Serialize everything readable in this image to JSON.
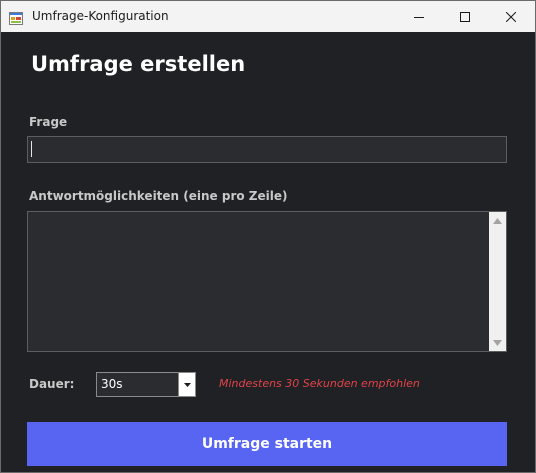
{
  "window": {
    "title": "Umfrage-Konfiguration",
    "icon": "app-form-icon",
    "controls": [
      "minimize-icon",
      "maximize-icon",
      "close-icon"
    ]
  },
  "form": {
    "heading": "Umfrage erstellen",
    "question": {
      "label": "Frage",
      "value": ""
    },
    "answers": {
      "label": "Antwortmöglichkeiten (eine pro Zeile)",
      "value": ""
    },
    "duration": {
      "label": "Dauer:",
      "selected": "30s",
      "hint": "Mindestens 30 Sekunden empfohlen"
    },
    "submit_label": "Umfrage starten"
  },
  "colors": {
    "background": "#202124",
    "field": "#2b2c30",
    "accent": "#5865f2",
    "hint": "#e0434a"
  }
}
